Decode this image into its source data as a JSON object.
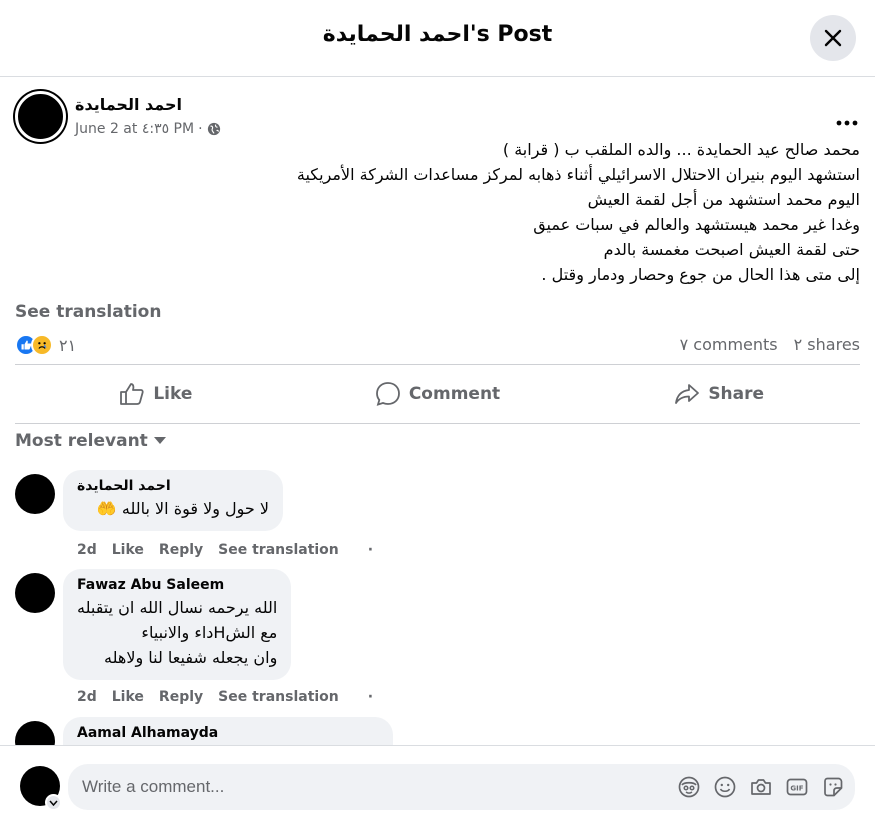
{
  "header": {
    "title": "احمد الحمايدة's Post"
  },
  "post": {
    "author": "احمد الحمايدة",
    "timestamp": "June 2 at ٤:٣٥ PM",
    "meta_separator": "·",
    "lines": [
      "محمد صالح عيد الحمايدة ... والده الملقب ب ( قرابة )",
      "استشهد اليوم بنيران الاحتلال الاسرائيلي أثناء ذهابه لمركز مساعدات الشركة الأمريكية",
      "اليوم محمد استشهد من أجل لقمة العيش",
      "وغدا غير محمد هيستشهد والعالم في سبات عميق",
      "حتى لقمة العيش اصبحت مغمسة بالدم",
      "إلى متى هذا الحال من جوع وحصار ودمار وقتل ."
    ],
    "see_translation": "See translation"
  },
  "stats": {
    "reaction_count": "٢١",
    "comments": "٧ comments",
    "shares": "٢ shares"
  },
  "actions": {
    "like": "Like",
    "comment": "Comment",
    "share": "Share"
  },
  "sort": {
    "label": "Most relevant"
  },
  "comments": [
    {
      "name": "احمد الحمايدة",
      "text": [
        "لا حول ولا قوة الا بالله 🤲"
      ],
      "time": "2d",
      "like": "Like",
      "reply": "Reply",
      "translate": "See translation",
      "dot": "·"
    },
    {
      "name": "Fawaz Abu Saleem",
      "text": [
        "الله يرحمه نسال الله ان يتقبله",
        "مع الشHداء والانبياء",
        "وان يجعله شفيعا لنا ولاهله"
      ],
      "time": "2d",
      "like": "Like",
      "reply": "Reply",
      "translate": "See translation",
      "dot": "·"
    },
    {
      "name": "Aamal Alhamayda"
    }
  ],
  "composer": {
    "placeholder": "Write a comment..."
  },
  "icons": {
    "close": "close-icon",
    "more": "more-icon",
    "globe": "globe-icon",
    "like": "thumbs-up-icon",
    "comment": "comment-icon",
    "share": "share-icon",
    "sort": "caret-down-icon",
    "avatar": "avatar-icon",
    "sticker": "sticker-icon",
    "emoji": "emoji-icon",
    "camera": "camera-icon",
    "gif": "gif-icon",
    "avatar_sticker": "avatar-sticker-icon"
  },
  "colors": {
    "accent": "#1877f2",
    "muted": "#65676b",
    "bubble": "#f0f2f5",
    "divider": "#ced0d4"
  }
}
